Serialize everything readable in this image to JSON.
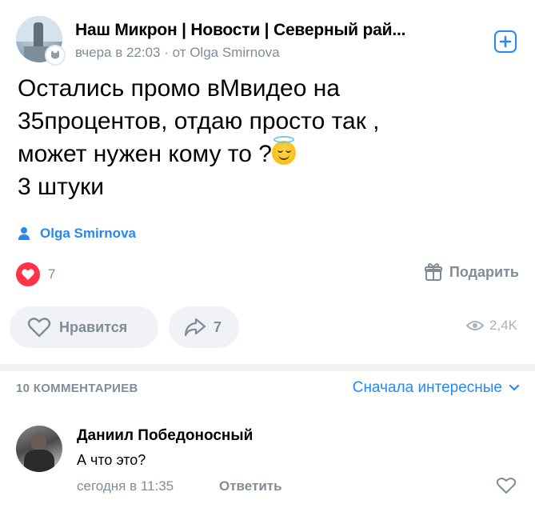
{
  "post": {
    "group_title": "Наш Микрон | Новости | Северный рай...",
    "meta": "вчера в 22:03 · от Olga Smirnova",
    "text": "Остались промо вМвидео на\n35процентов, отдаю просто так ,\nможет нужен кому то ?",
    "text_line4": "3 штуки",
    "emoji": "smiling-face-with-halo",
    "author_sign": "Olga Smirnova",
    "reactions_count": "7",
    "gift_label": "Подарить",
    "like_label": "Нравится",
    "share_count": "7",
    "views": "2,4K"
  },
  "comments": {
    "count_label": "10 КОММЕНТАРИЕВ",
    "sort_label": "Сначала интересные",
    "items": [
      {
        "author": "Даниил Победоносный",
        "text": "А что это?",
        "time": "сегодня в 11:35",
        "reply_label": "Ответить"
      }
    ]
  },
  "colors": {
    "accent": "#2787f5",
    "secondary_text": "#818c99",
    "reaction_heart": "#ff3347",
    "pill_background": "#f0f2f5"
  },
  "icons": [
    "subscribe-plus-icon",
    "author-person-icon",
    "heart-reaction-icon",
    "gift-icon",
    "heart-outline-icon",
    "share-arrow-icon",
    "eye-icon",
    "chevron-down-icon"
  ]
}
